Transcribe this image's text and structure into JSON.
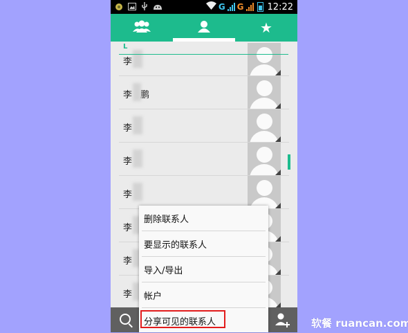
{
  "status_bar": {
    "icons": [
      "app-icon",
      "image-icon",
      "usb-icon",
      "android-icon"
    ],
    "network_1": "G",
    "network_2": "G",
    "time": "12:22"
  },
  "tabs": [
    {
      "icon": "groups-icon",
      "selected": false
    },
    {
      "icon": "person-icon",
      "selected": true
    },
    {
      "icon": "star-icon",
      "selected": false
    }
  ],
  "section_letter": "L",
  "contacts": [
    {
      "surname": "李",
      "given": ""
    },
    {
      "surname": "李",
      "given": "鹏"
    },
    {
      "surname": "李",
      "given": ""
    },
    {
      "surname": "李",
      "given": ""
    },
    {
      "surname": "李",
      "given": ""
    },
    {
      "surname": "李",
      "given": ""
    },
    {
      "surname": "李",
      "given": ""
    },
    {
      "surname": "李",
      "given": ""
    }
  ],
  "menu": {
    "items": [
      "删除联系人",
      "要显示的联系人",
      "导入/导出",
      "帐户",
      "分享可见的联系人"
    ],
    "highlighted_index": 4,
    "highlight_color": "#e21b1b"
  },
  "colors": {
    "accent": "#1dbb8d",
    "background": "#a2a2fe"
  },
  "watermark": "软餐 ruancan.com"
}
